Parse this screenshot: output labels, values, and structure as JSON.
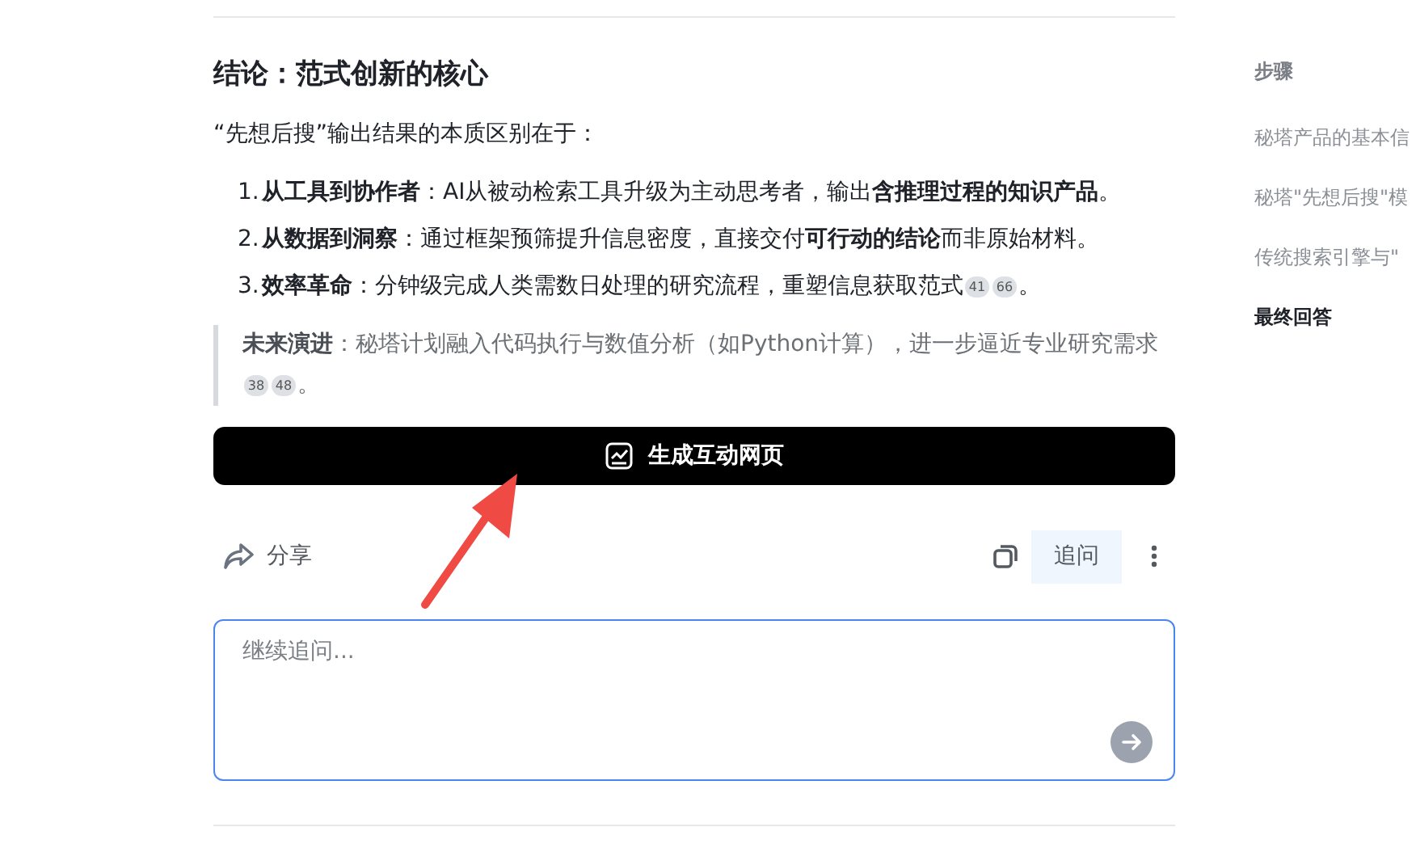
{
  "article": {
    "heading": "结论：范式创新的核心",
    "intro": "“先想后搜”输出结果的本质区别在于：",
    "list": [
      {
        "marker": "1.",
        "text": "**从工具到协作者**：AI从被动检索工具升级为主动思考者，输出**含推理过程的知识产品**。"
      },
      {
        "marker": "2.",
        "text": "**从数据到洞察**：通过框架预筛提升信息密度，直接交付**可行动的结论**而非原始材料。"
      },
      {
        "marker": "3.",
        "text": "**效率革命**：分钟级完成人类需数日处理的研究流程，重塑信息获取范式",
        "citations": [
          "41",
          "66"
        ],
        "end": "。"
      }
    ],
    "quote": {
      "text": "**未来演进**：秘塔计划融入代码执行与数值分析（如Python计算），进一步逼近专业研究需求",
      "citations": [
        "38",
        "48"
      ],
      "end": "。"
    },
    "generate_button": "生成互动网页"
  },
  "actions": {
    "share": "分享",
    "follow_up": "追问"
  },
  "composer": {
    "placeholder": "继续追问..."
  },
  "sidebar": {
    "title": "步骤",
    "items": [
      {
        "label": "秘塔产品的基本信",
        "selected": false
      },
      {
        "label": "秘塔\"先想后搜\"模",
        "selected": false
      },
      {
        "label": "传统搜索引擎与\"",
        "selected": false
      },
      {
        "label": "最终回答",
        "selected": true
      }
    ]
  }
}
